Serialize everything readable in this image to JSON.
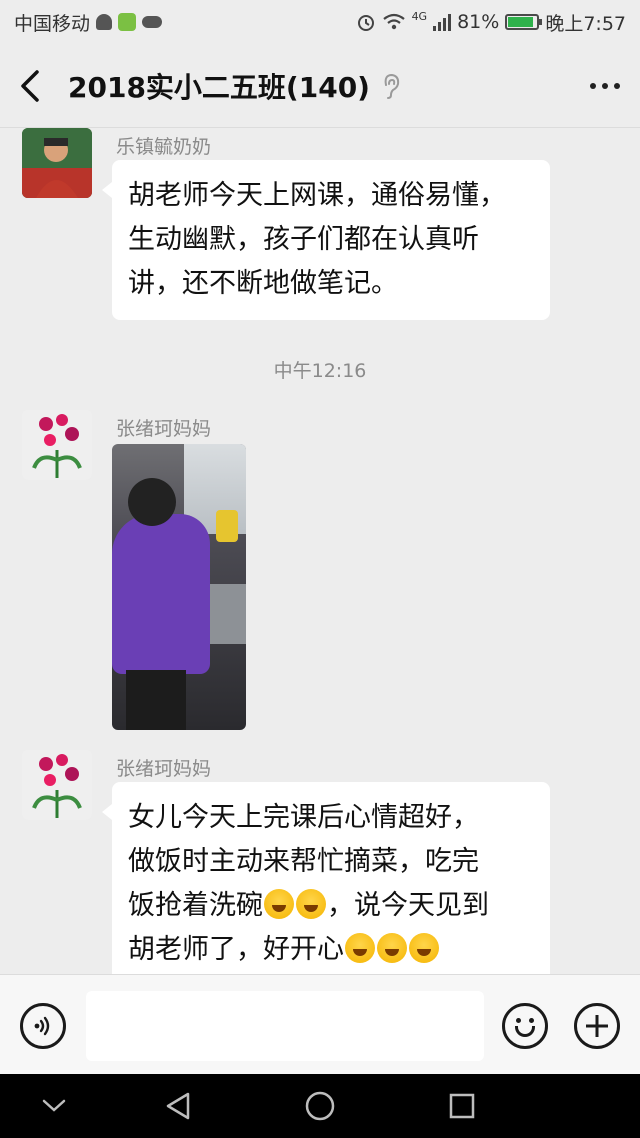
{
  "status_bar": {
    "carrier": "中国移动",
    "network": "4G",
    "battery": "81%",
    "time": "晚上7:57"
  },
  "header": {
    "title": "2018实小二五班(140)"
  },
  "messages": [
    {
      "sender": "乐镇毓奶奶",
      "type": "text",
      "text": "胡老师今天上网课，通俗易懂，\n生动幽默，孩子们都在认真听\n讲，还不断地做笔记。"
    },
    {
      "type": "timestamp",
      "text": "中午12:16"
    },
    {
      "sender": "张绪珂妈妈",
      "type": "image"
    },
    {
      "sender": "张绪珂妈妈",
      "type": "text",
      "lines": [
        "女儿今天上完课后心情超好，",
        "做饭时主动来帮忙摘菜，吃完",
        "饭抢着洗碗",
        "，说今天见到",
        "胡老师了，好开心"
      ]
    }
  ],
  "input_bar": {
    "placeholder": ""
  },
  "icons": {
    "back": "back-icon",
    "ear": "ear-icon",
    "more": "more-icon",
    "voice": "voice-icon",
    "emoji": "emoji-icon",
    "plus": "plus-icon",
    "nav_down": "chevron-down-icon",
    "nav_back": "triangle-back-icon",
    "nav_home": "circle-home-icon",
    "nav_recent": "square-recent-icon"
  },
  "colors": {
    "background": "#ededed",
    "bubble": "#ffffff",
    "accent_battery": "#2fb24c"
  }
}
